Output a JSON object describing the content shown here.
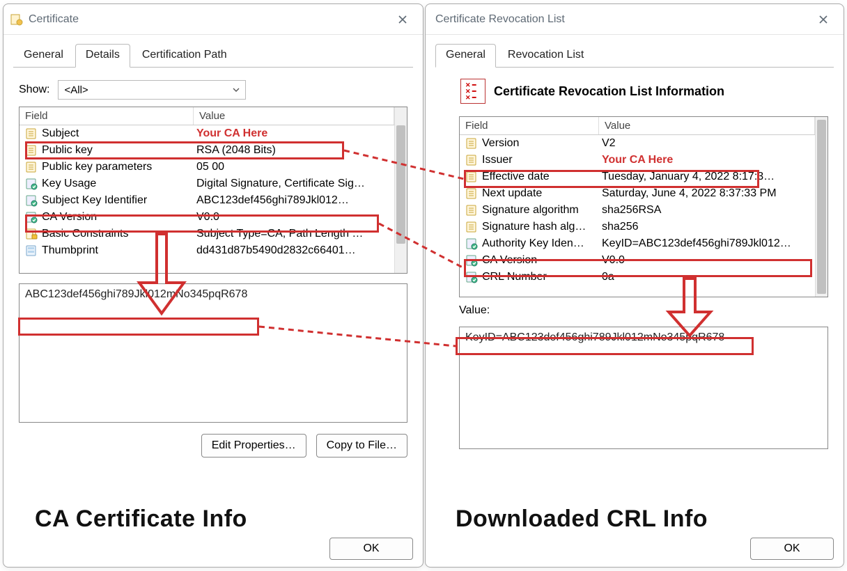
{
  "left": {
    "title": "Certificate",
    "tabs": [
      "General",
      "Details",
      "Certification Path"
    ],
    "active_tab": "Details",
    "show_label": "Show:",
    "show_value": "<All>",
    "header_field": "Field",
    "header_value": "Value",
    "rows": [
      {
        "field": "Subject",
        "value": "Your CA Here",
        "icon": "doc",
        "hl": true
      },
      {
        "field": "Public key",
        "value": "RSA (2048 Bits)",
        "icon": "doc"
      },
      {
        "field": "Public key parameters",
        "value": "05 00",
        "icon": "doc"
      },
      {
        "field": "Key Usage",
        "value": "Digital Signature, Certificate Sig…",
        "icon": "ext"
      },
      {
        "field": "Subject Key Identifier",
        "value": "ABC123def456ghi789Jkl012…",
        "icon": "ext",
        "box": true
      },
      {
        "field": "CA Version",
        "value": "V0.0",
        "icon": "ext"
      },
      {
        "field": "Basic Constraints",
        "value": "Subject Type=CA, Path Length …",
        "icon": "lock"
      },
      {
        "field": "Thumbprint",
        "value": "dd431d87b5490d2832c66401…",
        "icon": "th"
      }
    ],
    "detail_value": "ABC123def456ghi789Jkl012mNo345pqR678",
    "edit_btn": "Edit Properties…",
    "copy_btn": "Copy to File…",
    "ok": "OK",
    "caption": "CA Certificate Info"
  },
  "right": {
    "title": "Certificate Revocation List",
    "tabs": [
      "General",
      "Revocation List"
    ],
    "active_tab": "General",
    "info_title": "Certificate Revocation List Information",
    "header_field": "Field",
    "header_value": "Value",
    "rows": [
      {
        "field": "Version",
        "value": "V2",
        "icon": "doc"
      },
      {
        "field": "Issuer",
        "value": "Your CA Here",
        "icon": "doc",
        "hl": true,
        "box": true
      },
      {
        "field": "Effective date",
        "value": "Tuesday, January 4, 2022 8:17:3…",
        "icon": "doc"
      },
      {
        "field": "Next update",
        "value": "Saturday, June 4, 2022 8:37:33 PM",
        "icon": "doc"
      },
      {
        "field": "Signature algorithm",
        "value": "sha256RSA",
        "icon": "doc"
      },
      {
        "field": "Signature hash alg…",
        "value": "sha256",
        "icon": "doc"
      },
      {
        "field": "Authority Key Iden…",
        "value": "KeyID=ABC123def456ghi789Jkl012…",
        "icon": "ext",
        "box": true
      },
      {
        "field": "CA Version",
        "value": "V0.0",
        "icon": "ext"
      },
      {
        "field": "CRL Number",
        "value": "0a",
        "icon": "ext"
      }
    ],
    "value_label": "Value:",
    "detail_value": "KeyID=ABC123def456ghi789Jkl012mNo345pqR678",
    "ok": "OK",
    "caption": "Downloaded CRL Info"
  },
  "annotations": {
    "arrow_color": "#d03030"
  }
}
